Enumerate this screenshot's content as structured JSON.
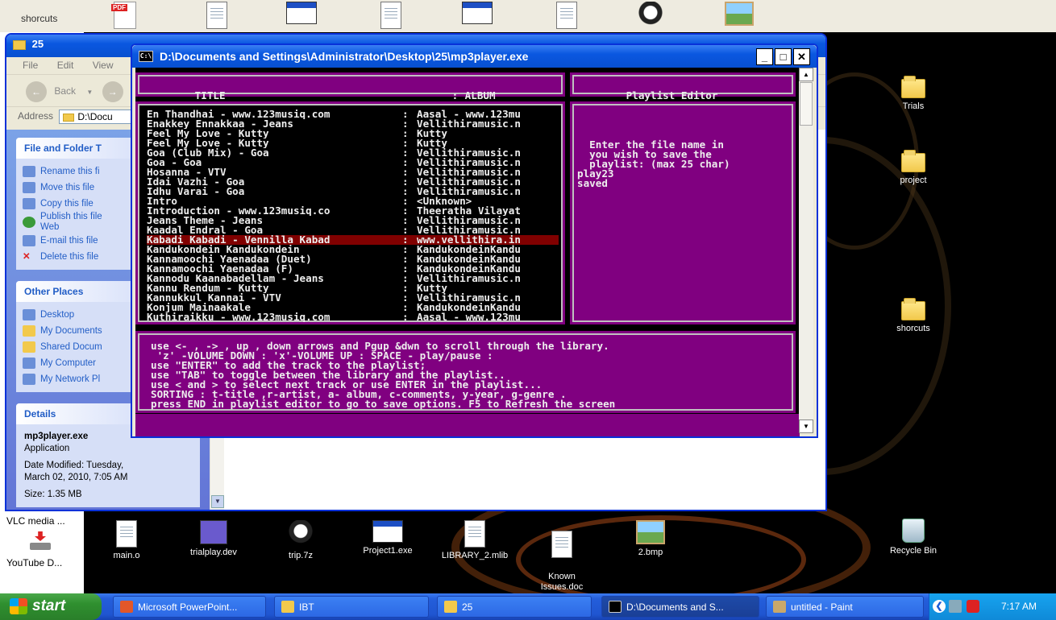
{
  "top_strip": {
    "shortcuts_label": "shorcuts"
  },
  "explorer": {
    "title": "25",
    "menu": [
      "File",
      "Edit",
      "View"
    ],
    "back_label": "Back",
    "address_label": "Address",
    "address_value": "D:\\Docu",
    "file_tasks_title": "File and Folder T",
    "file_tasks": [
      "Rename this fi",
      "Move this file",
      "Copy this file",
      "Publish this file",
      "Web",
      "E-mail this file",
      "Delete this file"
    ],
    "other_places_title": "Other Places",
    "other_places": [
      "Desktop",
      "My Documents",
      "Shared Docum",
      "My Computer",
      "My Network Pl"
    ],
    "details_title": "Details",
    "details_name": "mp3player.exe",
    "details_type": "Application",
    "details_modified_1": "Date Modified: Tuesday,",
    "details_modified_2": "March 02, 2010, 7:05 AM",
    "details_size": "Size: 1.35 MB"
  },
  "console": {
    "title": "D:\\Documents and Settings\\Administrator\\Desktop\\25\\mp3player.exe",
    "icon_text": "C:\\",
    "header_title": "TITLE",
    "header_sep": ":",
    "header_album": "ALBUM",
    "playlist_header": "Playlist Editor",
    "library": [
      {
        "title": "En Thandhai - www.123musiq.com",
        "album": "Aasal - www.123mu"
      },
      {
        "title": "Enakkey Ennakkaa - Jeans",
        "album": "Vellithiramusic.n"
      },
      {
        "title": "Feel My Love - Kutty",
        "album": "Kutty"
      },
      {
        "title": "Feel My Love - Kutty",
        "album": "Kutty"
      },
      {
        "title": "Goa (Club Mix) - Goa",
        "album": "Vellithiramusic.n"
      },
      {
        "title": "Goa - Goa",
        "album": "Vellithiramusic.n"
      },
      {
        "title": "Hosanna - VTV",
        "album": "Vellithiramusic.n"
      },
      {
        "title": "Idai Vazhi - Goa",
        "album": "Vellithiramusic.n"
      },
      {
        "title": "Idhu Varai - Goa",
        "album": "Vellithiramusic.n"
      },
      {
        "title": "Intro",
        "album": "<Unknown>"
      },
      {
        "title": "Introduction - www.123musiq.co",
        "album": "Theeratha Vilayat"
      },
      {
        "title": "Jeans Theme - Jeans",
        "album": "Vellithiramusic.n"
      },
      {
        "title": "Kaadal Endral - Goa",
        "album": "Vellithiramusic.n"
      },
      {
        "title": "Kabadi Kabadi - Vennilla Kabad",
        "album": "www.vellithira.in"
      },
      {
        "title": "Kandukondein Kandukondein",
        "album": "KandukondeinKandu"
      },
      {
        "title": "Kannamoochi Yaenadaa (Duet)",
        "album": "KandukondeinKandu"
      },
      {
        "title": "Kannamoochi Yaenadaa (F)",
        "album": "KandukondeinKandu"
      },
      {
        "title": "Kannodu Kaanabadellam - Jeans",
        "album": "Vellithiramusic.n"
      },
      {
        "title": "Kannu Rendum - Kutty",
        "album": "Kutty"
      },
      {
        "title": "Kannukkul Kannai - VTV",
        "album": "Vellithiramusic.n"
      },
      {
        "title": "Konjum Mainaakale",
        "album": "KandukondeinKandu"
      },
      {
        "title": "Kuthiraikku - www.123musiq.com",
        "album": "Aasal - www.123mu"
      }
    ],
    "selected_index": 13,
    "playlist_lines": [
      "  Enter the file name in",
      "  you wish to save the",
      "  playlist: (max 25 char)",
      "play23",
      "saved"
    ],
    "help_lines": [
      "use <- , -> , up , down arrows and Pgup &dwn to scroll through the library.",
      " 'z' -VOLUME DOWN : 'x'-VOLUME UP : SPACE - play/pause :",
      "use \"ENTER\" to add the track to the playlist;",
      "use \"TAB\" to toggle between the library and the playlist..",
      "use < and > to select next track or use ENTER in the playlist...",
      "SORTING : t-title ,r-artist, a- album, c-comments, y-year, g-genre .",
      "press END in playlist editor to go to save options. F5 to Refresh the screen"
    ]
  },
  "desktop": {
    "right_icons": [
      "Trials",
      "project",
      "shorcuts",
      "Recycle Bin"
    ],
    "bottom_icons": [
      "main.o",
      "trialplay.dev",
      "trip.7z",
      "Project1.exe",
      "LIBRARY_2.mlib",
      "Known\nIssues.doc",
      "2.bmp"
    ],
    "left_bottom": [
      "VLC media ...",
      "YouTube D..."
    ]
  },
  "taskbar": {
    "start_label": "start",
    "buttons": [
      "Microsoft PowerPoint...",
      "IBT",
      "25",
      "D:\\Documents and S...",
      "untitled - Paint"
    ],
    "clock": "7:17 AM"
  },
  "colors": {
    "console_panel": "#800080",
    "selection": "#800000",
    "xp_blue": "#0a57e0"
  }
}
